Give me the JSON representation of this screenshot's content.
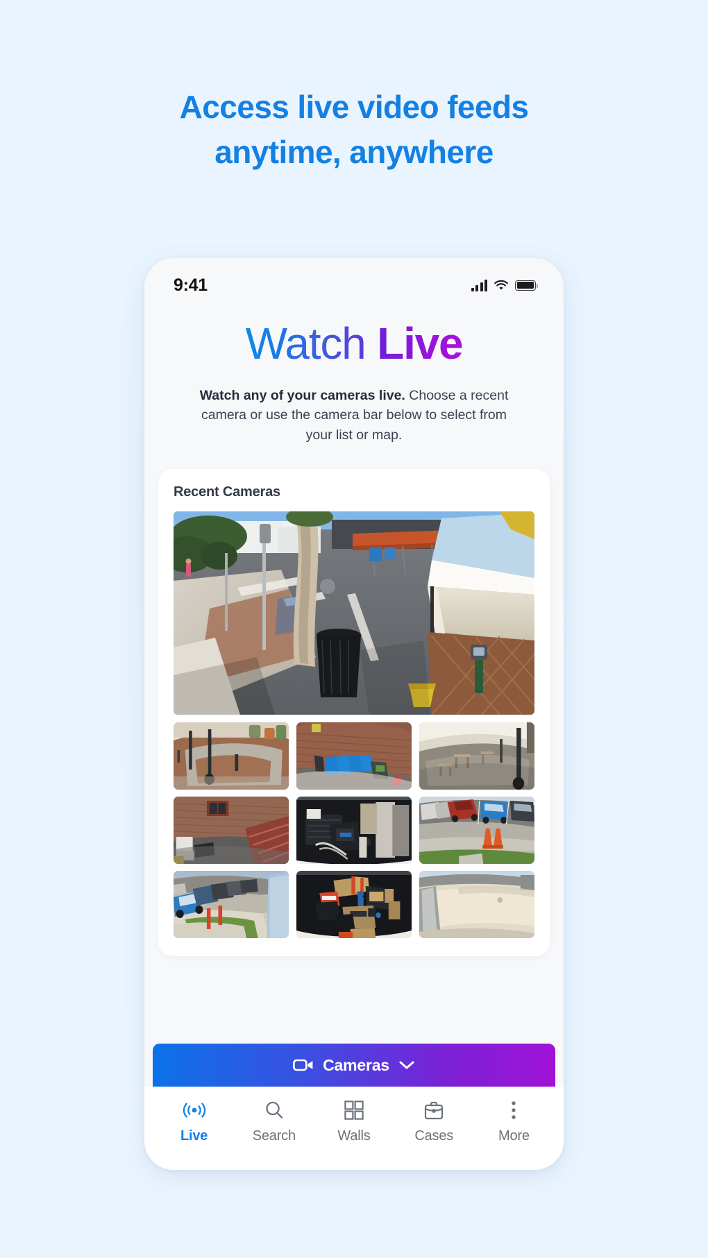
{
  "marketing": {
    "headline_line1": "Access live video feeds",
    "headline_line2": "anytime, anywhere",
    "headline_color": "#1380e4"
  },
  "statusbar": {
    "time": "9:41",
    "cellular_icon": "cellular-signal-icon",
    "wifi_icon": "wifi-icon",
    "battery_icon": "battery-icon"
  },
  "hero": {
    "title_part1": "Watch",
    "title_part2": "Live",
    "subtitle_bold": "Watch any of your cameras live.",
    "subtitle_rest": " Choose a recent camera or use the camera bar below to select from your list or map.",
    "title_gradient_start": "#0b8ae8",
    "title_gradient_end": "#a911d4"
  },
  "recent_cameras": {
    "section_title": "Recent Cameras",
    "main_feed": {
      "name": "downtown-street-corner",
      "description": "Street corner with tree, trash can, market tents and outdoor seating"
    },
    "thumbnails": [
      {
        "name": "brick-plaza-walkway",
        "description": "Brick plaza walkway with planters and light poles"
      },
      {
        "name": "recycling-bins-alley",
        "description": "Blue recycling bins lined along a brick wall"
      },
      {
        "name": "covered-patio-seating",
        "description": "Covered patio with tables under white canopy"
      },
      {
        "name": "back-alley-stairs",
        "description": "Brick back alley with window and red stair railing"
      },
      {
        "name": "equipment-room",
        "description": "Dark equipment room interior with racks and cabling"
      },
      {
        "name": "parking-lot-cones",
        "description": "Parking lot with red SUV, blue car and orange cones"
      },
      {
        "name": "employee-parking-lot",
        "description": "Parking lot with blue cars, grass strip and bollards"
      },
      {
        "name": "warehouse-office",
        "description": "Dark warehouse office with desks, boxes and chairs"
      },
      {
        "name": "empty-concrete-lot",
        "description": "Empty sunlit concrete lot beside a wall"
      }
    ]
  },
  "camera_bar": {
    "label": "Cameras",
    "camera_icon": "video-camera-icon",
    "chevron_icon": "chevron-down-icon",
    "gradient_start": "#0b72e8",
    "gradient_end": "#a011d6"
  },
  "tabbar": {
    "active_color": "#1380e4",
    "inactive_color": "#6c727c",
    "tabs": [
      {
        "label": "Live",
        "icon": "broadcast-icon",
        "active": true
      },
      {
        "label": "Search",
        "icon": "search-icon",
        "active": false
      },
      {
        "label": "Walls",
        "icon": "grid-icon",
        "active": false
      },
      {
        "label": "Cases",
        "icon": "briefcase-icon",
        "active": false
      },
      {
        "label": "More",
        "icon": "more-dots-icon",
        "active": false
      }
    ]
  }
}
